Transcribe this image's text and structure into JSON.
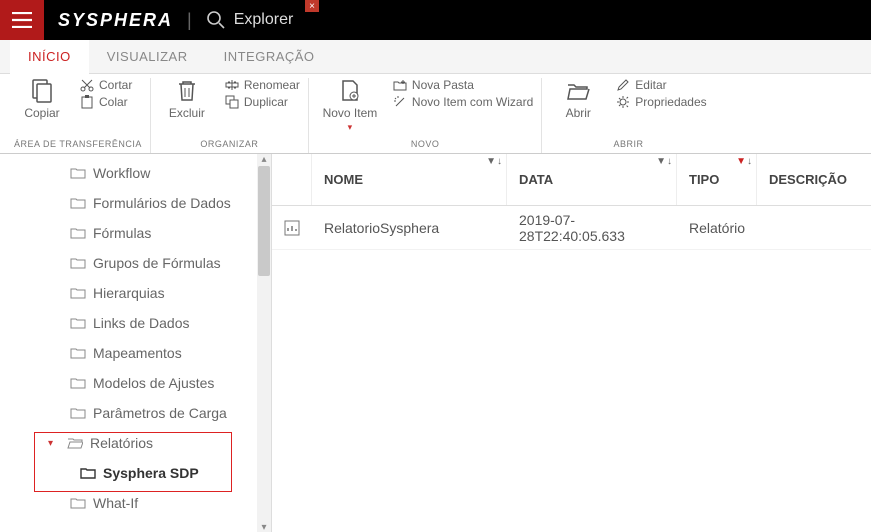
{
  "topbar": {
    "brand": "SYSPHERA",
    "title": "Explorer",
    "close": "×"
  },
  "tabs": [
    {
      "label": "INÍCIO",
      "active": true
    },
    {
      "label": "VISUALIZAR",
      "active": false
    },
    {
      "label": "INTEGRAÇÃO",
      "active": false
    }
  ],
  "ribbon": {
    "groups": [
      {
        "label": "ÁREA DE TRANSFERÊNCIA",
        "big": {
          "label": "Copiar"
        },
        "small": [
          {
            "label": "Cortar",
            "icon": "scissors-icon"
          },
          {
            "label": "Colar",
            "icon": "paste-icon"
          }
        ]
      },
      {
        "label": "ORGANIZAR",
        "big": {
          "label": "Excluir"
        },
        "small": [
          {
            "label": "Renomear",
            "icon": "rename-icon"
          },
          {
            "label": "Duplicar",
            "icon": "duplicate-icon"
          }
        ]
      },
      {
        "label": "NOVO",
        "big": {
          "label": "Novo Item"
        },
        "small": [
          {
            "label": "Nova Pasta",
            "icon": "new-folder-icon"
          },
          {
            "label": "Novo Item com Wizard",
            "icon": "wizard-icon"
          }
        ]
      },
      {
        "label": "ABRIR",
        "big": {
          "label": "Abrir"
        },
        "small": [
          {
            "label": "Editar",
            "icon": "edit-icon"
          },
          {
            "label": "Propriedades",
            "icon": "properties-icon"
          }
        ]
      }
    ]
  },
  "sidebar": {
    "items": [
      {
        "label": "Workflow"
      },
      {
        "label": "Formulários de Dados"
      },
      {
        "label": "Fórmulas"
      },
      {
        "label": "Grupos de Fórmulas"
      },
      {
        "label": "Hierarquias"
      },
      {
        "label": "Links de Dados"
      },
      {
        "label": "Mapeamentos"
      },
      {
        "label": "Modelos de Ajustes"
      },
      {
        "label": "Parâmetros de Carga"
      },
      {
        "label": "Relatórios",
        "expanded": true
      },
      {
        "label": "Sysphera SDP",
        "child": true,
        "selected": true
      },
      {
        "label": "What-If"
      }
    ]
  },
  "grid": {
    "headers": {
      "nome": "NOME",
      "data": "DATA",
      "tipo": "TIPO",
      "descricao": "DESCRIÇÃO"
    },
    "rows": [
      {
        "nome": "RelatorioSysphera",
        "data": "2019-07-28T22:40:05.633",
        "tipo": "Relatório",
        "descricao": ""
      }
    ]
  }
}
